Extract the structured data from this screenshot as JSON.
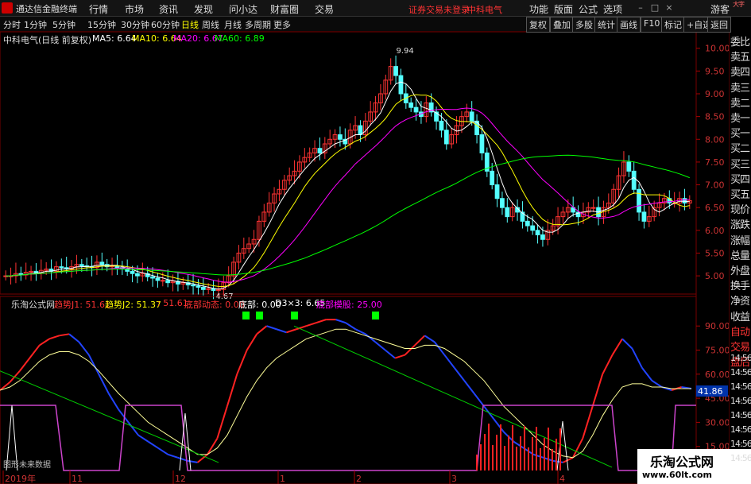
{
  "window": {
    "app_title": "通达信金融终端",
    "menus": [
      "行情",
      "市场",
      "资讯",
      "发现",
      "问小达",
      "财富圈",
      "交易"
    ],
    "warning": "证券交易未登录",
    "stock_top": "中科电气",
    "right_menus": [
      "功能",
      "版面",
      "公式",
      "选项"
    ],
    "guest": "游客",
    "win_buttons": [
      "–",
      "□",
      "×"
    ]
  },
  "toolbar": {
    "periods": [
      "分时",
      "1分钟",
      "5分钟",
      "15分钟",
      "30分钟",
      "60分钟",
      "日线",
      "周线",
      "月线",
      "多周期",
      "更多"
    ],
    "active_period": "日线",
    "right_tools": [
      "复权",
      "叠加",
      "多股",
      "统计",
      "画线",
      "F10",
      "标记",
      "+自选",
      "返回"
    ]
  },
  "info": {
    "title": "中科电气(日线 前复权)",
    "ma_labels": [
      "MA5: 6.64",
      "MA10: 6.64",
      "MA20: 6.67",
      "MA60: 6.89"
    ],
    "ma_colors": [
      "#ffffff",
      "#ffff00",
      "#ff00ff",
      "#00ff00"
    ]
  },
  "sidebar": {
    "items": [
      "委比",
      "卖五",
      "卖四",
      "卖三",
      "卖二",
      "卖一",
      "买一",
      "买二",
      "买三",
      "买四",
      "买五",
      "现价",
      "涨跌",
      "涨幅",
      "总量",
      "外盘",
      "换手",
      "净资",
      "收益",
      "自动",
      "交易",
      "盘后"
    ],
    "times": [
      "14:56",
      "14:56",
      "14:56",
      "14:56",
      "14:56",
      "14:56",
      "14:56",
      "14:56"
    ],
    "corner": "大字"
  },
  "indicator": {
    "name": "乐淘公式网",
    "labels": [
      "趋势J1: 51.61",
      "趋势J2: 51.37",
      ": 51.61",
      "底部动态: 0.00",
      "底部: 0.00",
      "D3×3: 6.65",
      "底部模股: 25.00"
    ],
    "label_colors": [
      "#ff3333",
      "#ffff00",
      "#ff3333",
      "#ff3333",
      "#ffffff",
      "#ffffff",
      "#ff00ff"
    ],
    "current_value": "41.86",
    "bottom_note": "图形未来数据"
  },
  "watermark": {
    "line1": "乐淘公式网",
    "line2": "www.60lt.com"
  },
  "chart_data": [
    {
      "type": "candlestick",
      "title": "中科电气(日线 前复权)",
      "ylim": [
        4.6,
        10.1
      ],
      "yticks": [
        "10.00",
        "9.50",
        "9.00",
        "8.50",
        "8.00",
        "7.50",
        "7.00",
        "6.50",
        "6.00",
        "5.50",
        "5.00"
      ],
      "x_labels": [
        "2019年",
        "11",
        "12",
        "1",
        "2",
        "3",
        "4"
      ],
      "annotations": [
        {
          "text": "9.94",
          "type": "high"
        },
        {
          "text": "4.67",
          "type": "low"
        }
      ],
      "close": [
        5.0,
        5.0,
        5.05,
        5.02,
        5.08,
        5.1,
        5.05,
        5.12,
        5.15,
        5.1,
        5.2,
        5.18,
        5.15,
        5.2,
        5.25,
        5.22,
        5.2,
        5.18,
        5.3,
        5.25,
        5.2,
        5.22,
        5.18,
        5.15,
        5.1,
        5.05,
        5.0,
        5.05,
        4.98,
        4.95,
        4.9,
        4.9,
        4.85,
        4.88,
        4.82,
        4.85,
        4.8,
        4.78,
        4.75,
        4.7,
        4.72,
        4.68,
        4.7,
        4.85,
        5.0,
        5.3,
        5.5,
        5.6,
        5.7,
        5.8,
        6.2,
        6.4,
        6.6,
        6.8,
        6.9,
        7.1,
        7.2,
        7.3,
        7.5,
        7.6,
        7.7,
        7.8,
        7.7,
        7.9,
        8.0,
        8.1,
        8.0,
        7.9,
        8.2,
        8.3,
        8.1,
        8.4,
        8.6,
        8.8,
        9.0,
        9.3,
        9.6,
        9.4,
        9.0,
        8.8,
        8.7,
        8.6,
        8.5,
        8.8,
        8.6,
        8.4,
        8.2,
        7.9,
        8.1,
        8.3,
        8.5,
        8.6,
        8.4,
        8.1,
        7.7,
        7.3,
        7.0,
        6.7,
        6.5,
        6.3,
        6.5,
        6.4,
        6.2,
        6.1,
        6.0,
        5.9,
        5.8,
        6.0,
        6.1,
        6.3,
        6.4,
        6.5,
        6.4,
        6.3,
        6.4,
        6.5,
        6.5,
        6.3,
        6.5,
        6.6,
        6.9,
        7.2,
        7.5,
        7.3,
        6.9,
        6.4,
        6.2,
        6.3,
        6.5,
        6.6,
        6.7,
        6.6,
        6.6,
        6.7,
        6.6,
        6.65
      ],
      "series": [
        {
          "name": "MA5",
          "value": "6.64"
        },
        {
          "name": "MA10",
          "value": "6.64"
        },
        {
          "name": "MA20",
          "value": "6.67"
        },
        {
          "name": "MA60",
          "value": "6.89"
        }
      ]
    },
    {
      "type": "line",
      "title": "乐淘公式网",
      "ylim": [
        0,
        100
      ],
      "yticks": [
        "90.00",
        "75.00",
        "60.00",
        "45.00",
        "30.00",
        "15.00"
      ],
      "series": [
        {
          "name": "趋势J1",
          "values": [
            50,
            55,
            62,
            70,
            78,
            82,
            84,
            85,
            80,
            72,
            60,
            48,
            38,
            30,
            22,
            18,
            14,
            10,
            8,
            6,
            5,
            10,
            20,
            40,
            60,
            75,
            85,
            90,
            88,
            86,
            88,
            90,
            92,
            94,
            94,
            92,
            88,
            85,
            80,
            75,
            70,
            72,
            78,
            84,
            80,
            72,
            64,
            56,
            48,
            40,
            32,
            24,
            18,
            14,
            10,
            8,
            6,
            5,
            8,
            20,
            40,
            60,
            72,
            82,
            76,
            64,
            56,
            52,
            50,
            52,
            51
          ]
        },
        {
          "name": "趋势J2",
          "values": [
            50,
            52,
            56,
            62,
            68,
            72,
            74,
            74,
            72,
            68,
            62,
            55,
            48,
            42,
            36,
            30,
            26,
            22,
            18,
            14,
            10,
            10,
            14,
            22,
            34,
            46,
            56,
            64,
            70,
            74,
            78,
            82,
            84,
            86,
            88,
            88,
            86,
            84,
            82,
            80,
            78,
            76,
            76,
            78,
            78,
            76,
            72,
            68,
            62,
            56,
            48,
            40,
            34,
            28,
            22,
            16,
            12,
            9,
            8,
            12,
            22,
            34,
            44,
            52,
            54,
            54,
            52,
            52,
            51,
            51,
            51
          ]
        }
      ]
    }
  ]
}
